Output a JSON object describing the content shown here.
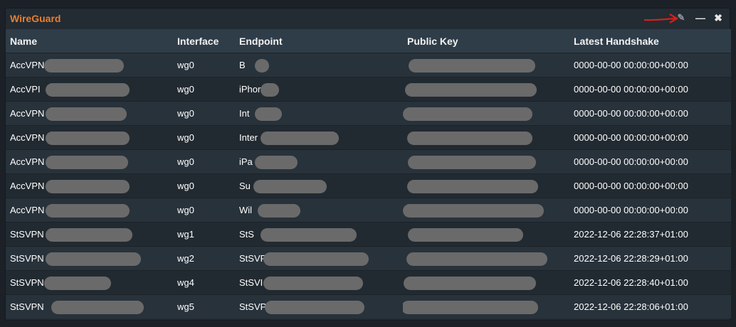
{
  "widget": {
    "title": "WireGuard",
    "controls": {
      "edit_icon": "pencil-icon",
      "minimize_label": "—",
      "close_label": "✖"
    }
  },
  "table": {
    "columns": [
      "Name",
      "Interface",
      "Endpoint",
      "Public Key",
      "Latest Handshake"
    ],
    "rows": [
      {
        "name": "AccVPN",
        "iface": "wg0",
        "endpoint": "B",
        "handshake": "0000-00-00 00:00:00+00:00"
      },
      {
        "name": "AccVPI",
        "iface": "wg0",
        "endpoint": "iPhor",
        "handshake": "0000-00-00 00:00:00+00:00"
      },
      {
        "name": "AccVPN",
        "iface": "wg0",
        "endpoint": "Int",
        "handshake": "0000-00-00 00:00:00+00:00"
      },
      {
        "name": "AccVPN",
        "iface": "wg0",
        "endpoint": "Inter",
        "handshake": "0000-00-00 00:00:00+00:00"
      },
      {
        "name": "AccVPN",
        "iface": "wg0",
        "endpoint": "iPa",
        "handshake": "0000-00-00 00:00:00+00:00"
      },
      {
        "name": "AccVPN",
        "iface": "wg0",
        "endpoint": "Su",
        "handshake": "0000-00-00 00:00:00+00:00"
      },
      {
        "name": "AccVPN",
        "iface": "wg0",
        "endpoint": "Wil",
        "handshake": "0000-00-00 00:00:00+00:00"
      },
      {
        "name": "StSVPN",
        "iface": "wg1",
        "endpoint": "StS",
        "handshake": "2022-12-06 22:28:37+01:00"
      },
      {
        "name": "StSVPN",
        "iface": "wg2",
        "endpoint": "StSVP",
        "handshake": "2022-12-06 22:28:29+01:00"
      },
      {
        "name": "StSVPN",
        "iface": "wg4",
        "endpoint": "StSVI",
        "handshake": "2022-12-06 22:28:40+01:00"
      },
      {
        "name": "StSVPN",
        "iface": "wg5",
        "endpoint": "StSVP",
        "handshake": "2022-12-06 22:28:06+01:00"
      }
    ]
  },
  "colors": {
    "title": "#e97e2e",
    "header_bg": "#2f3d49",
    "annotation_arrow": "#d0221c",
    "redaction": "#6a6a6a"
  }
}
